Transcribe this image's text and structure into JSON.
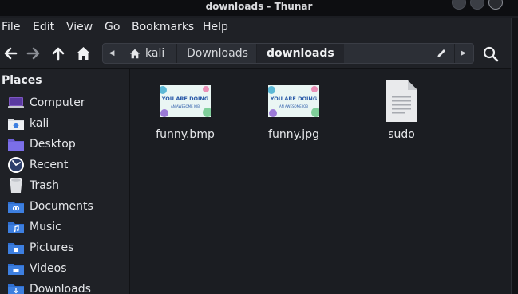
{
  "window": {
    "title": "downloads - Thunar"
  },
  "menubar": {
    "items": [
      "File",
      "Edit",
      "View",
      "Go",
      "Bookmarks",
      "Help"
    ]
  },
  "toolbar": {
    "back_icon": "arrow-left-icon",
    "forward_icon": "arrow-right-icon",
    "up_icon": "arrow-up-icon",
    "home_icon": "home-icon"
  },
  "pathbar": {
    "crumbs": [
      "kali",
      "Downloads",
      "downloads"
    ],
    "active_index": 2
  },
  "sidebar": {
    "heading": "Places",
    "items": [
      {
        "label": "Computer",
        "icon": "computer-icon"
      },
      {
        "label": "kali",
        "icon": "home-folder-icon"
      },
      {
        "label": "Desktop",
        "icon": "desktop-folder-icon"
      },
      {
        "label": "Recent",
        "icon": "recent-icon"
      },
      {
        "label": "Trash",
        "icon": "trash-icon"
      },
      {
        "label": "Documents",
        "icon": "documents-folder-icon"
      },
      {
        "label": "Music",
        "icon": "music-folder-icon"
      },
      {
        "label": "Pictures",
        "icon": "pictures-folder-icon"
      },
      {
        "label": "Videos",
        "icon": "videos-folder-icon"
      },
      {
        "label": "Downloads",
        "icon": "downloads-folder-icon"
      }
    ]
  },
  "files": [
    {
      "name": "funny.bmp",
      "type": "image",
      "thumb_text": [
        "YOU ARE DOING",
        "AN AWESOME JOB"
      ]
    },
    {
      "name": "funny.jpg",
      "type": "image",
      "thumb_text": [
        "YOU ARE DOING",
        "AN AWESOME JOB"
      ]
    },
    {
      "name": "sudo",
      "type": "text"
    }
  ],
  "colors": {
    "folder_blue": "#3d7fe0",
    "background": "#1b1d22",
    "panel": "#1f2126"
  }
}
